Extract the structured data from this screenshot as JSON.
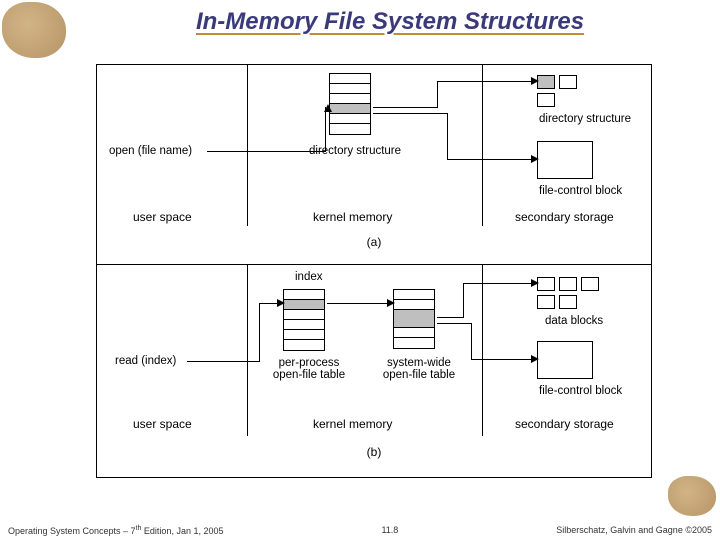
{
  "title": "In-Memory File System Structures",
  "panelA": {
    "call": "open (file name)",
    "midLabel": "directory structure",
    "legend": {
      "dir": "directory structure",
      "fcb": "file-control block"
    },
    "regions": {
      "left": "user space",
      "mid": "kernel memory",
      "right": "secondary storage"
    },
    "caption": "(a)"
  },
  "panelB": {
    "call": "read (index)",
    "topMidLabel": "index",
    "midLabels": {
      "perProcess": "per-process open-file table",
      "systemWide": "system-wide open-file table"
    },
    "legend": {
      "data": "data blocks",
      "fcb": "file-control block"
    },
    "regions": {
      "left": "user space",
      "mid": "kernel memory",
      "right": "secondary storage"
    },
    "caption": "(b)"
  },
  "footer": {
    "left_prefix": "Operating System Concepts – 7",
    "left_sup": "th",
    "left_suffix": " Edition, Jan 1, 2005",
    "center": "11.8",
    "right": "Silberschatz, Galvin and Gagne ©2005"
  }
}
